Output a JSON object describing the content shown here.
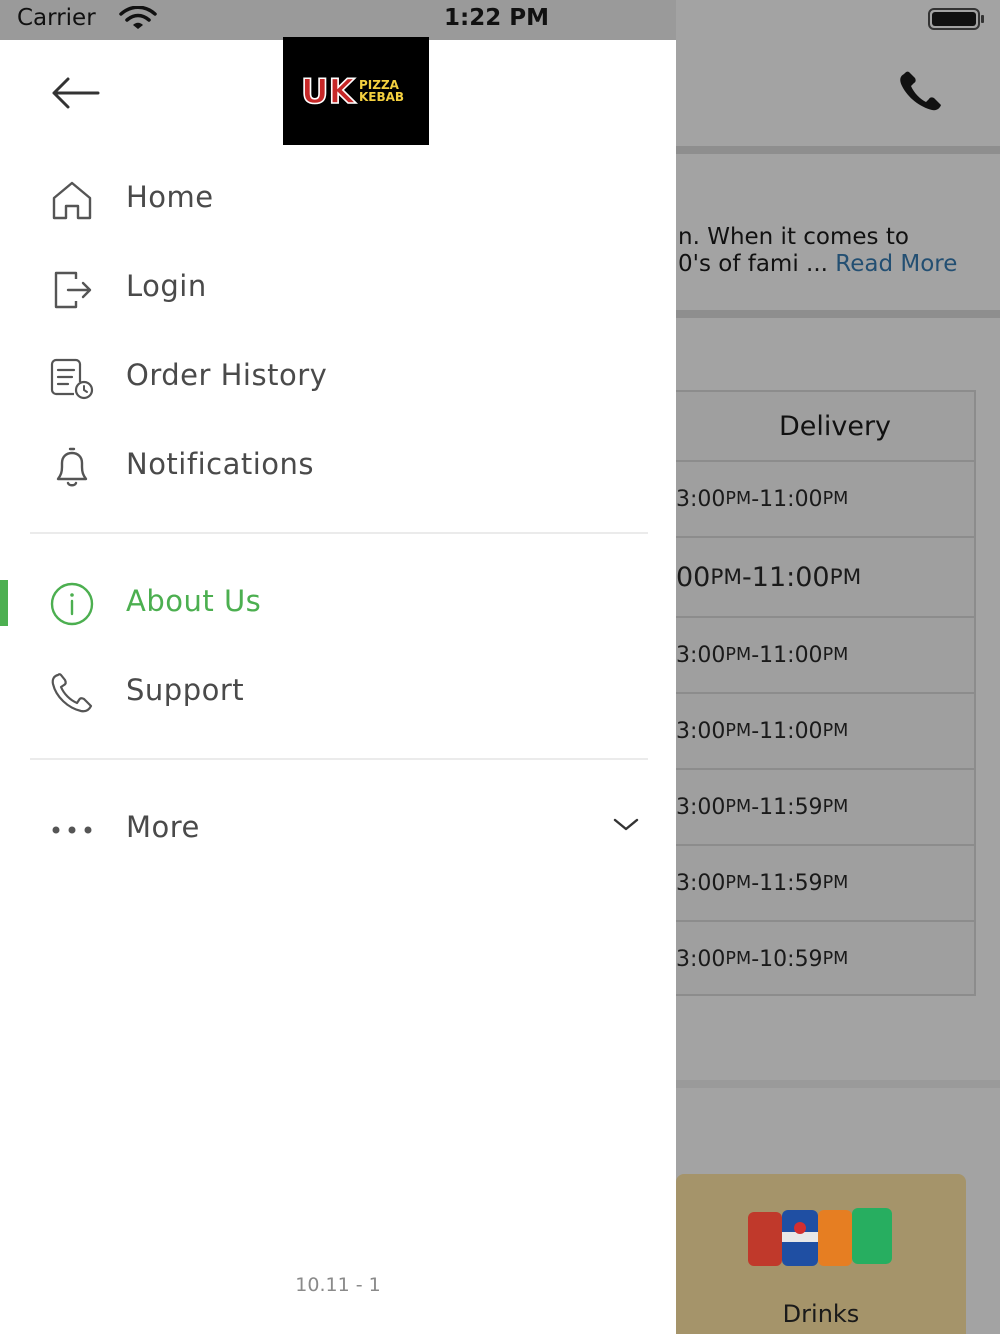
{
  "status_bar": {
    "carrier": "Carrier",
    "time": "1:22 PM"
  },
  "drawer": {
    "logo": {
      "main": "UK",
      "line1": "PIZZA",
      "line2": "KEBAB"
    },
    "items": [
      {
        "label": "Home",
        "icon": "home-icon"
      },
      {
        "label": "Login",
        "icon": "login-icon"
      },
      {
        "label": "Order History",
        "icon": "order-history-icon"
      },
      {
        "label": "Notifications",
        "icon": "bell-icon"
      },
      {
        "label": "About Us",
        "icon": "info-icon",
        "active": true
      },
      {
        "label": "Support",
        "icon": "phone-icon"
      },
      {
        "label": "More",
        "icon": "more-dots-icon"
      }
    ],
    "version": "10.11 - 1",
    "active_color": "#4caf50"
  },
  "background": {
    "about_line1": "n. When it comes to",
    "about_line2": "0's of fami ...",
    "read_more": "Read More",
    "hours_header": "Delivery",
    "hours_rows": [
      {
        "from": "3:00",
        "to": "11:00"
      },
      {
        "from": "00",
        "to": "11:00"
      },
      {
        "from": "3:00",
        "to": "11:00"
      },
      {
        "from": "3:00",
        "to": "11:00"
      },
      {
        "from": "3:00",
        "to": "11:59"
      },
      {
        "from": "3:00",
        "to": "11:59"
      },
      {
        "from": "3:00",
        "to": "10:59"
      }
    ],
    "pm": "PM",
    "drinks_label": "Drinks"
  }
}
